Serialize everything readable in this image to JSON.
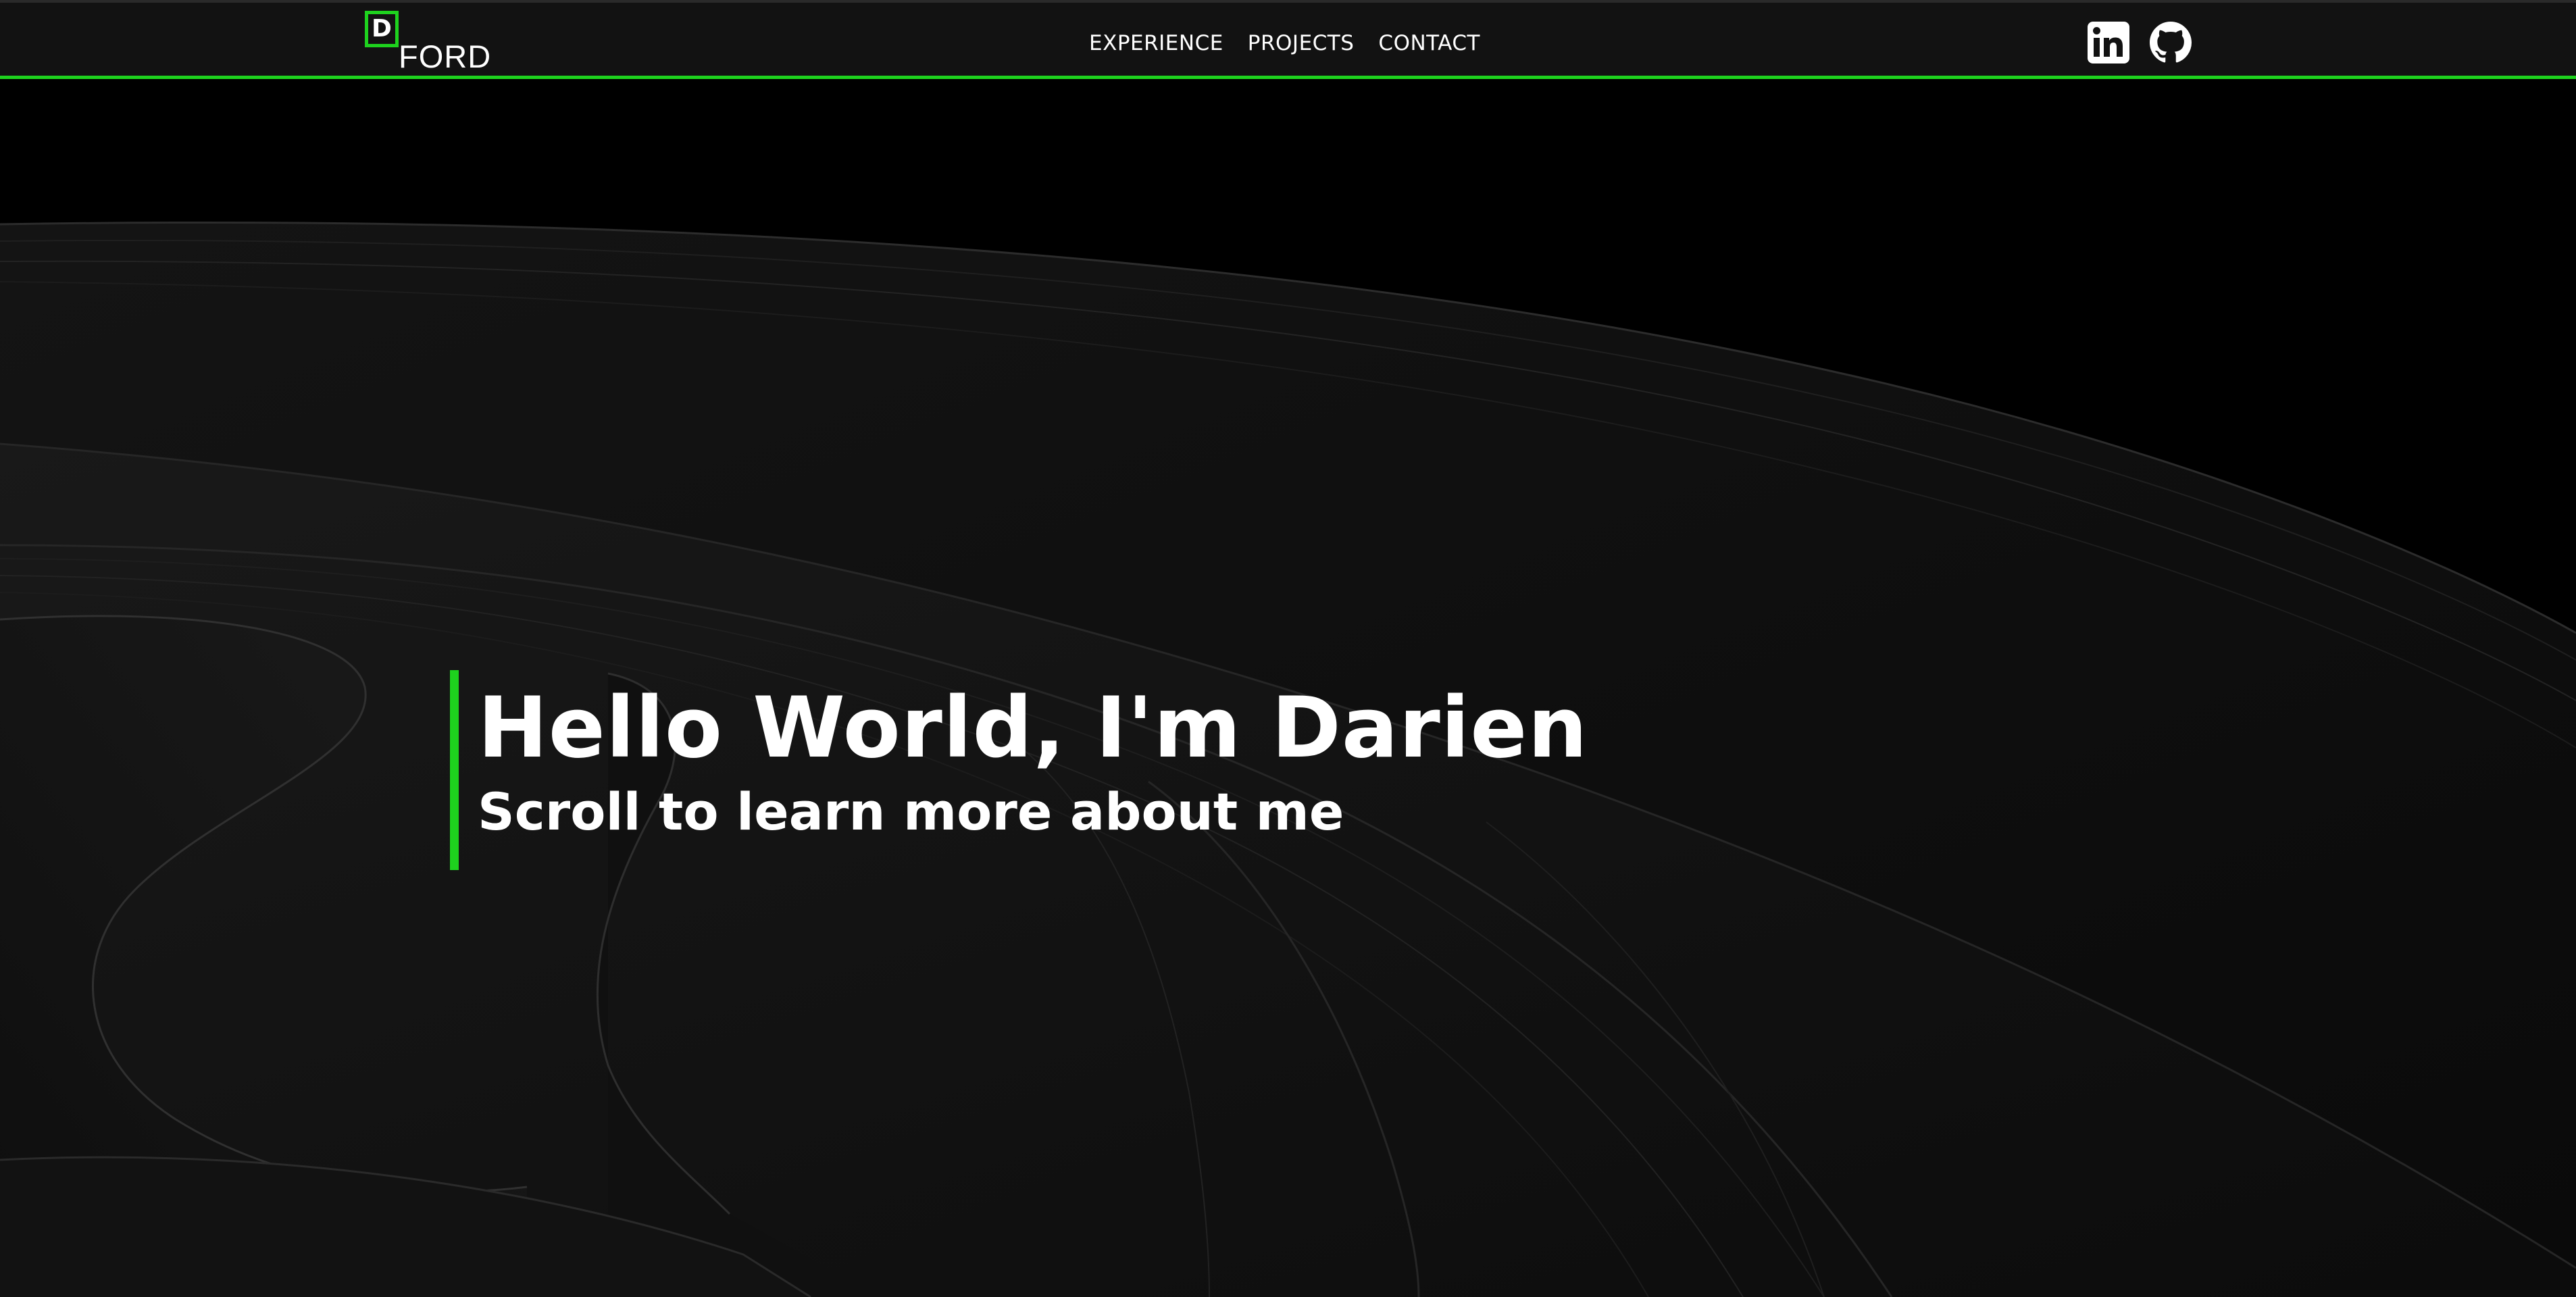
{
  "header": {
    "logo": {
      "letter": "D",
      "word": "FORD"
    },
    "nav": [
      {
        "label": "EXPERIENCE"
      },
      {
        "label": "PROJECTS"
      },
      {
        "label": "CONTACT"
      }
    ],
    "social": [
      {
        "icon": "linkedin-icon"
      },
      {
        "icon": "github-icon"
      }
    ]
  },
  "hero": {
    "title": "Hello World, I'm Darien",
    "subtitle": "Scroll to learn more about me"
  },
  "colors": {
    "accent": "#1ed21e",
    "header_bg": "#121212",
    "page_bg": "#000000",
    "text": "#ffffff"
  }
}
